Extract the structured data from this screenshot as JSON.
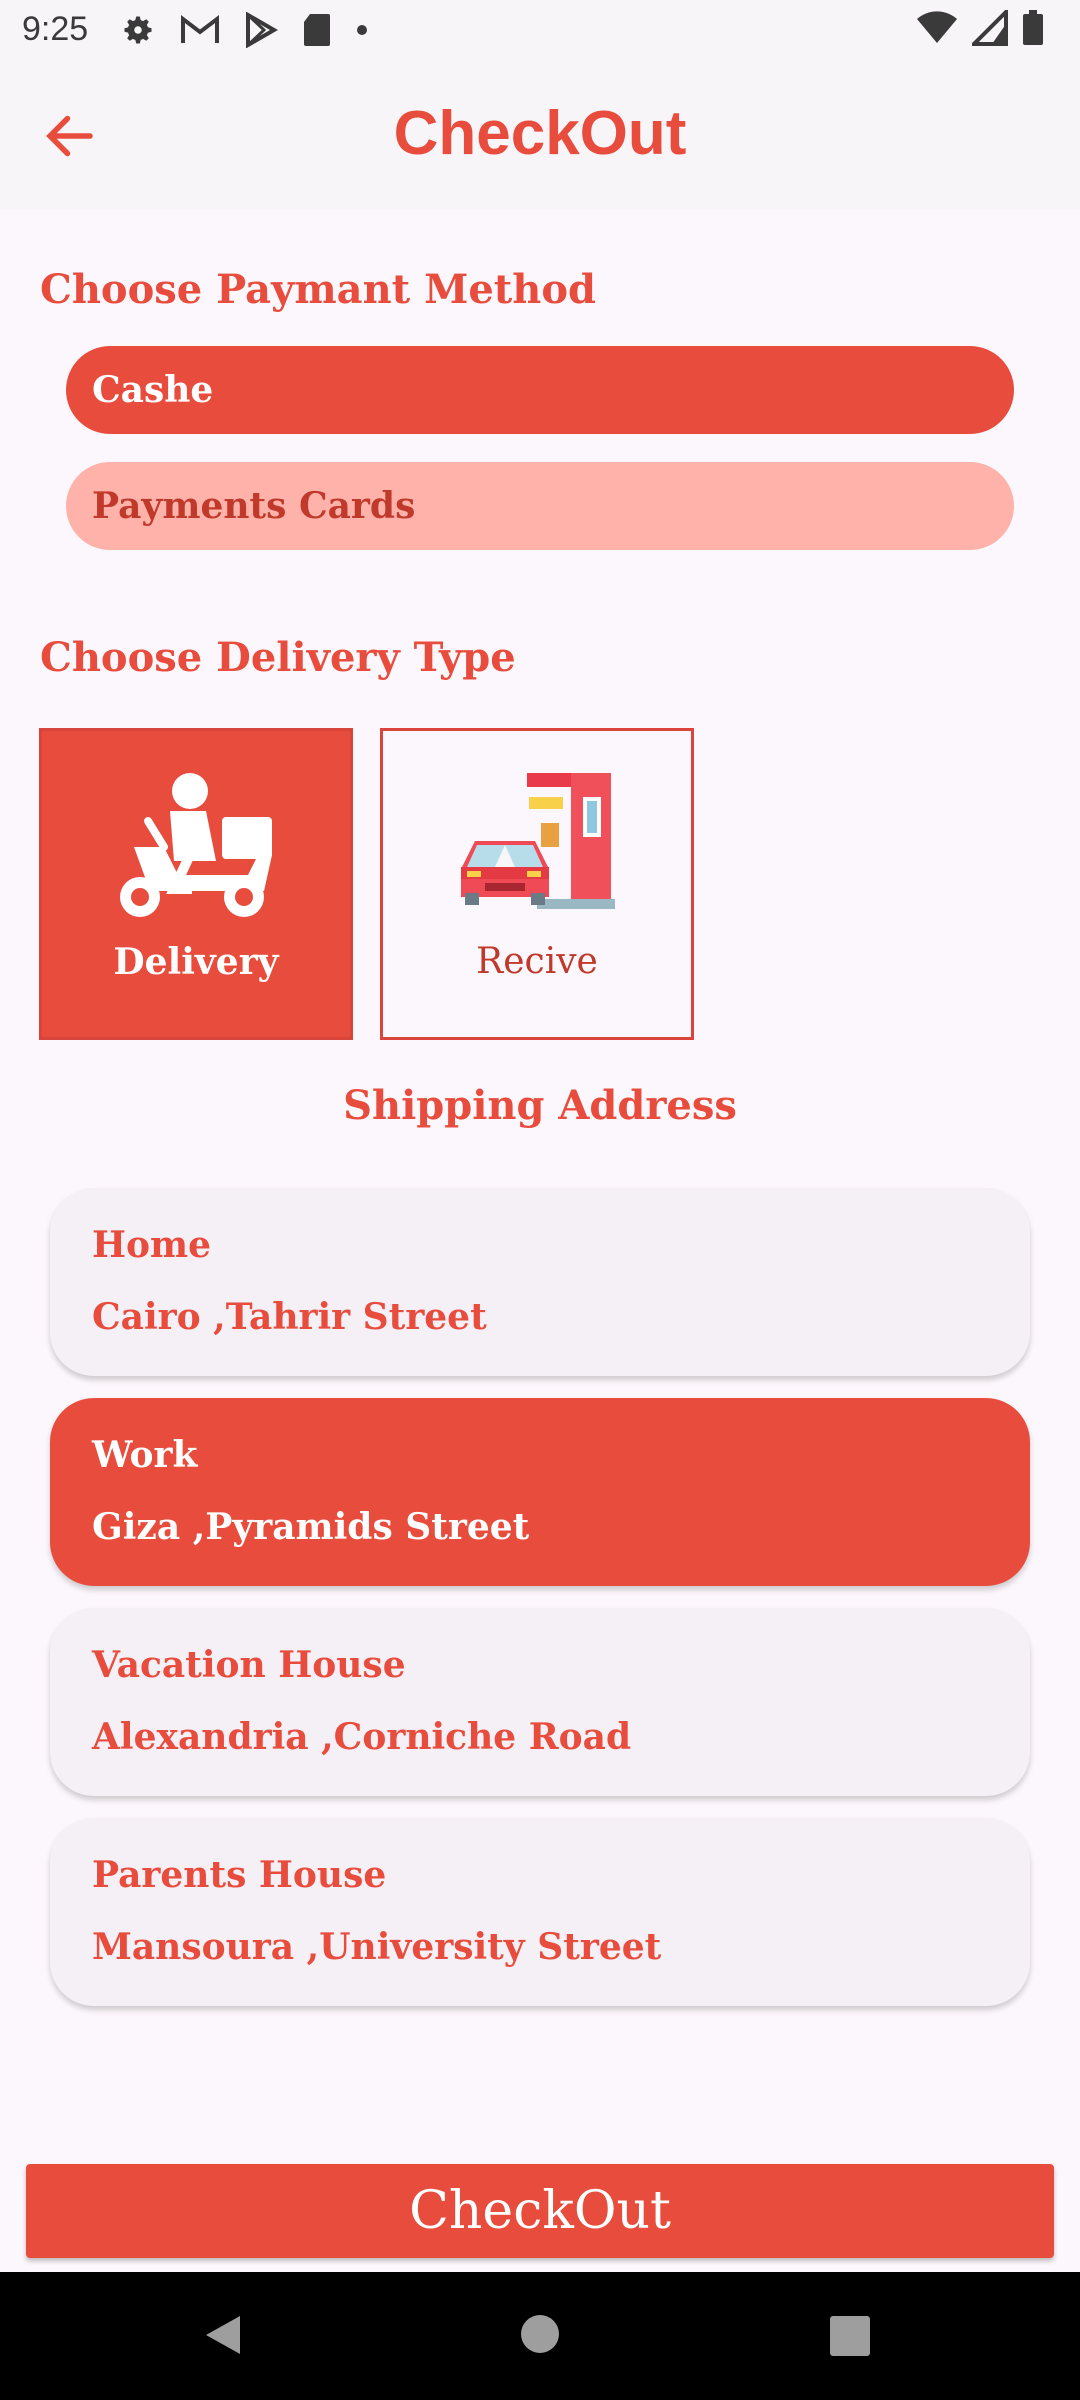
{
  "status_bar": {
    "time": "9:25"
  },
  "app_bar": {
    "title": "CheckOut"
  },
  "payment": {
    "title": "Choose Paymant Method",
    "options": [
      {
        "label": "Cashe",
        "selected": true
      },
      {
        "label": "Payments Cards",
        "selected": false
      }
    ]
  },
  "delivery": {
    "title": "Choose Delivery Type",
    "options": [
      {
        "label": "Delivery",
        "icon": "scooter-icon",
        "selected": true
      },
      {
        "label": "Recive",
        "icon": "drive-thru-icon",
        "selected": false
      }
    ]
  },
  "shipping": {
    "title": "Shipping Address",
    "addresses": [
      {
        "name": "Home",
        "address": "Cairo ,Tahrir Street",
        "selected": false
      },
      {
        "name": "Work",
        "address": "Giza ,Pyramids Street",
        "selected": true
      },
      {
        "name": "Vacation House",
        "address": "Alexandria ,Corniche Road",
        "selected": false
      },
      {
        "name": "Parents House",
        "address": "Mansoura ,University Street",
        "selected": false
      }
    ]
  },
  "checkout_button": {
    "label": "CheckOut"
  },
  "colors": {
    "accent": "#e84c3d",
    "accent_light": "#ffb2a9",
    "card_bg": "#f5eff6"
  }
}
